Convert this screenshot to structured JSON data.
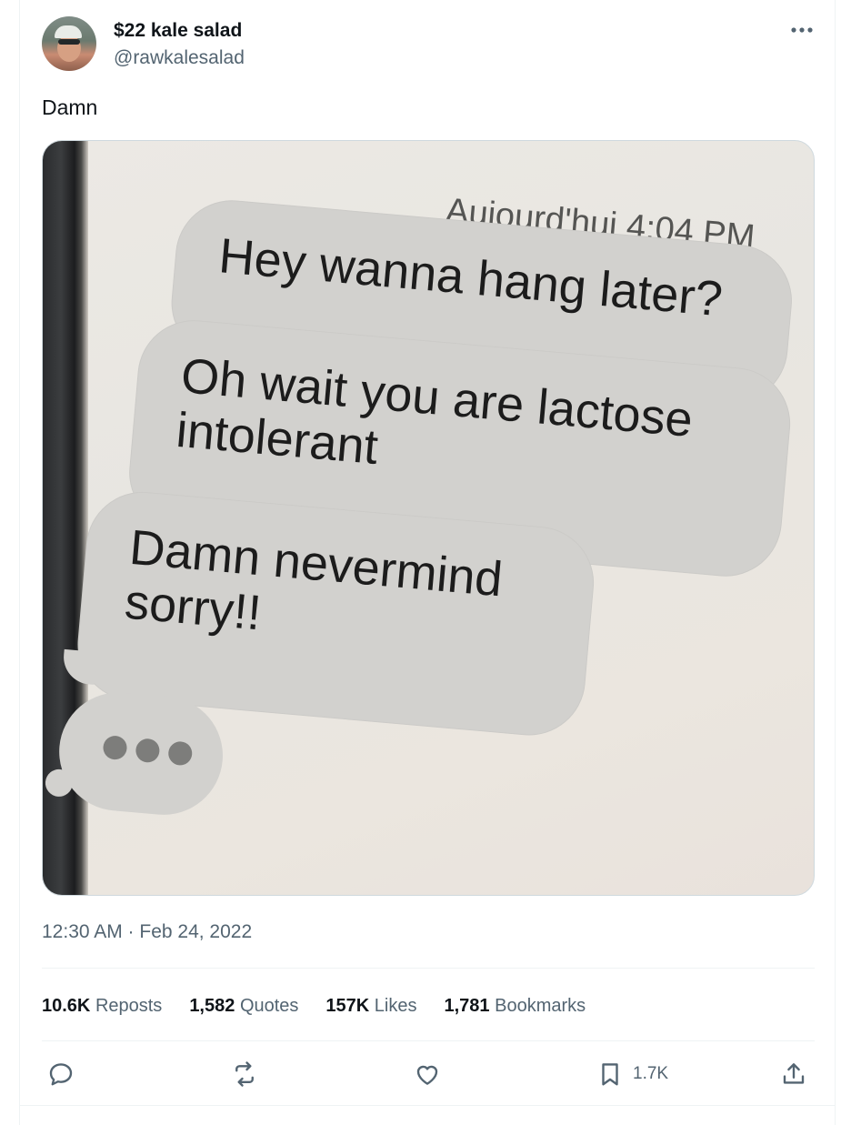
{
  "author": {
    "display_name": "$22 kale salad",
    "handle": "@rawkalesalad"
  },
  "tweet": {
    "text": "Damn",
    "timestamp": "12:30 AM · Feb 24, 2022"
  },
  "media": {
    "time_label": "Aujourd'hui 4:04 PM",
    "messages": [
      "Hey wanna hang later?",
      "Oh wait you are lactose intolerant",
      "Damn nevermind sorry!!"
    ]
  },
  "stats": {
    "reposts_count": "10.6K",
    "reposts_label": "Reposts",
    "quotes_count": "1,582",
    "quotes_label": "Quotes",
    "likes_count": "157K",
    "likes_label": "Likes",
    "bookmarks_count": "1,781",
    "bookmarks_label": "Bookmarks"
  },
  "actions": {
    "bookmark_count": "1.7K",
    "icons": [
      "reply-icon",
      "repost-icon",
      "like-icon",
      "bookmark-icon",
      "share-icon"
    ]
  },
  "colors": {
    "primary_text": "#0f1419",
    "secondary_text": "#536471",
    "divider": "#eff3f4"
  }
}
